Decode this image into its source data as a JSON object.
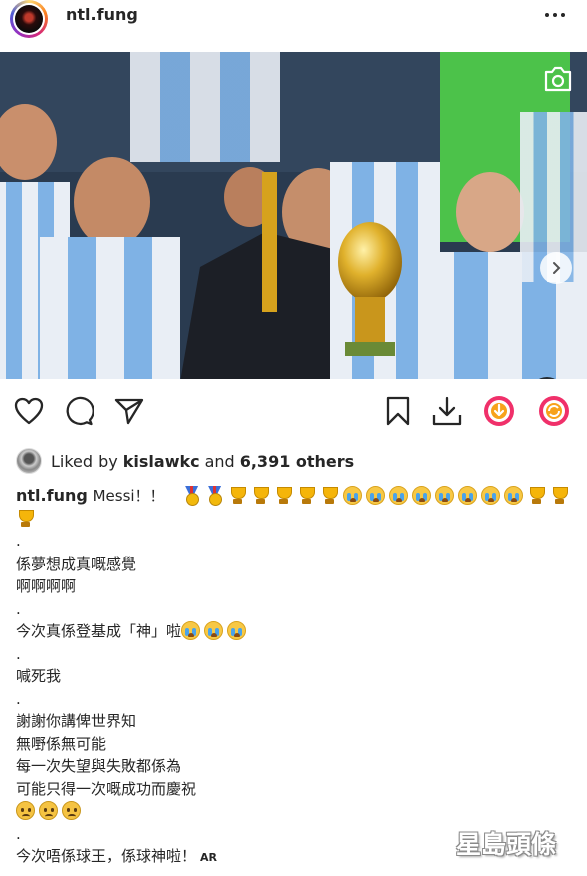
{
  "post": {
    "username": "ntl.fung",
    "more_icon": "more-horizontal-icon"
  },
  "media": {
    "camera_icon": "camera-icon",
    "next_icon": "chevron-right-icon",
    "mute_icon": "speaker-muted-icon",
    "carousel": {
      "total": 6,
      "active_index": 0
    }
  },
  "actions": {
    "like_icon": "heart-icon",
    "comment_icon": "comment-bubble-icon",
    "share_icon": "send-icon",
    "save_icon": "bookmark-icon",
    "download_icon": "download-icon",
    "extension_icon_1": "circle-download-icon",
    "extension_icon_2": "circle-refresh-icon"
  },
  "likes": {
    "prefix": "Liked by",
    "user": "kislawkc",
    "middle": "and",
    "others": "6,391 others"
  },
  "caption": {
    "owner": "ntl.fung",
    "first_text": "Messi！！",
    "lines": [
      ".",
      "係夢想成真嘅感覺",
      "啊啊啊啊",
      ".",
      "今次真係登基成「神」啦",
      ".",
      "喊死我",
      ".",
      "謝謝你講俾世界知",
      "無嘢係無可能",
      "每一次失望與失敗都係為",
      "可能只得一次嘅成功而慶祝",
      "",
      ".",
      "今次唔係球王，係球神啦！"
    ],
    "last_tag": "AR"
  },
  "watermark": {
    "text": "星島頭條"
  },
  "colors": {
    "text": "#262626",
    "ring_gradient": [
      "#feda75",
      "#fa7e1e",
      "#d62976",
      "#962fbf",
      "#4f5bd5"
    ],
    "extension_red": "#f0306a",
    "extension_orange": "#f7a21b"
  }
}
